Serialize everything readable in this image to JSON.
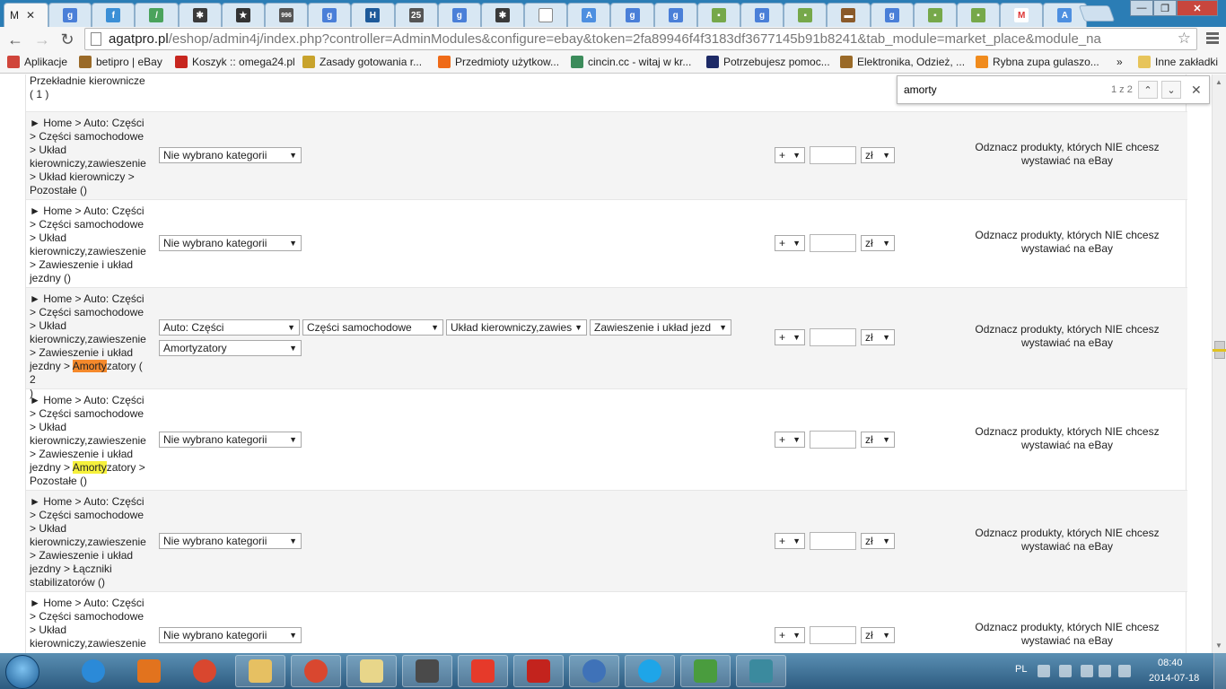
{
  "browser": {
    "active_tab_title": "M",
    "tab_icons": [
      "google-icon",
      "feather-icon",
      "pencil-icon",
      "star-icon",
      "circle-star-icon",
      "number-icon",
      "google-icon",
      "h-icon",
      "calendar-icon",
      "google-icon",
      "star-icon",
      "page-icon",
      "translate-icon",
      "google-icon",
      "google-icon",
      "puzzle-icon",
      "google-icon",
      "puzzle-icon",
      "shop-icon",
      "google-icon",
      "puzzle-icon",
      "puzzle-icon",
      "gmail-icon",
      "translate-icon"
    ],
    "tab_label_number": "996",
    "tab_label_h": "H",
    "tab_label_25": "25",
    "url_host": "agatpro.pl",
    "url_path": "/eshop/admin4j/index.php?controller=AdminModules&configure=ebay&token=2fa89946f4f3183df3677145b91b8241&tab_module=market_place&module_na",
    "bookmarks": [
      {
        "label": "Aplikacje",
        "color": "#d0453b"
      },
      {
        "label": "betipro | eBay",
        "color": "#9a6a28"
      },
      {
        "label": "Koszyk :: omega24.pl",
        "color": "#c7261f"
      },
      {
        "label": "Zasady gotowania r...",
        "color": "#c8a32c"
      },
      {
        "label": "Przedmioty użytkow...",
        "color": "#ef6a17"
      },
      {
        "label": "cincin.cc - witaj w kr...",
        "color": "#3c8c5b"
      },
      {
        "label": "Potrzebujesz pomoc...",
        "color": "#1d2a66"
      },
      {
        "label": "Elektronika, Odzież, ...",
        "color": "#9a6a28"
      },
      {
        "label": "Rybna zupa gulaszo...",
        "color": "#f08b1d"
      },
      {
        "label": "»",
        "color": ""
      },
      {
        "label": "Inne zakładki",
        "color": "#e7c45a"
      }
    ]
  },
  "find": {
    "query": "amorty",
    "count": "1 z 2"
  },
  "page": {
    "top_partial": {
      "line1": "Przekładnie kierownicze",
      "line2": "( 1 )"
    },
    "rows": [
      {
        "cat": [
          "► Home > Auto: Części",
          "> Części samochodowe",
          "> Układ",
          "kierowniczy,zawieszenie",
          "> Układ kierowniczy >",
          "Pozostałe ()"
        ]
      },
      {
        "cat": [
          "► Home > Auto: Części",
          "> Części samochodowe",
          "> Układ",
          "kierowniczy,zawieszenie",
          "> Zawieszenie i układ",
          "jezdny ()"
        ]
      },
      {
        "cat": [
          "► Home > Auto: Części",
          "> Części samochodowe",
          "> Układ",
          "kierowniczy,zawieszenie",
          "> Zawieszenie i układ"
        ],
        "cat_pre": "jezdny > ",
        "cat_hl": "Amorty",
        "cat_post": "zatory ( 2",
        "cat_tail": ")"
      },
      {
        "cat": [
          "► Home > Auto: Części",
          "> Części samochodowe",
          "> Układ",
          "kierowniczy,zawieszenie",
          "> Zawieszenie i układ"
        ],
        "cat_pre": "jezdny > ",
        "cat_hl": "Amorty",
        "cat_post": "zatory >",
        "cat_tail": "Pozostałe ()"
      },
      {
        "cat": [
          "► Home > Auto: Części",
          "> Części samochodowe",
          "> Układ",
          "kierowniczy,zawieszenie",
          "> Zawieszenie i układ",
          "jezdny > Łączniki",
          "stabilizatorów ()"
        ]
      },
      {
        "cat": [
          "► Home > Auto: Części",
          "> Części samochodowe",
          "> Układ",
          "kierowniczy,zawieszenie"
        ]
      }
    ],
    "no_category": "Nie wybrano kategorii",
    "selects_row3": [
      "Auto: Części",
      "Części samochodowe",
      "Układ kierowniczy,zawies",
      "Zawieszenie i układ jezd",
      "Amortyzatory"
    ],
    "op_value": "+",
    "currency": "zł",
    "note_line1": "Odznacz produkty, których NIE chcesz",
    "note_line2": "wystawiać na eBay"
  },
  "taskbar": {
    "language": "PL",
    "time": "08:40",
    "date": "2014-07-18",
    "apps": [
      "ie-icon",
      "media-player-icon",
      "chrome-icon",
      "file-explorer-icon",
      "chrome-icon",
      "emoticon-icon",
      "sublime-icon",
      "sun-icon",
      "filezilla-icon",
      "thunderbird-icon",
      "skype-icon",
      "notepad-icon",
      "monitor-icon"
    ]
  },
  "colors": {
    "tab_strip": "#2b7db5",
    "highlight_active": "#f5892b",
    "highlight_other": "#f6f13c"
  }
}
